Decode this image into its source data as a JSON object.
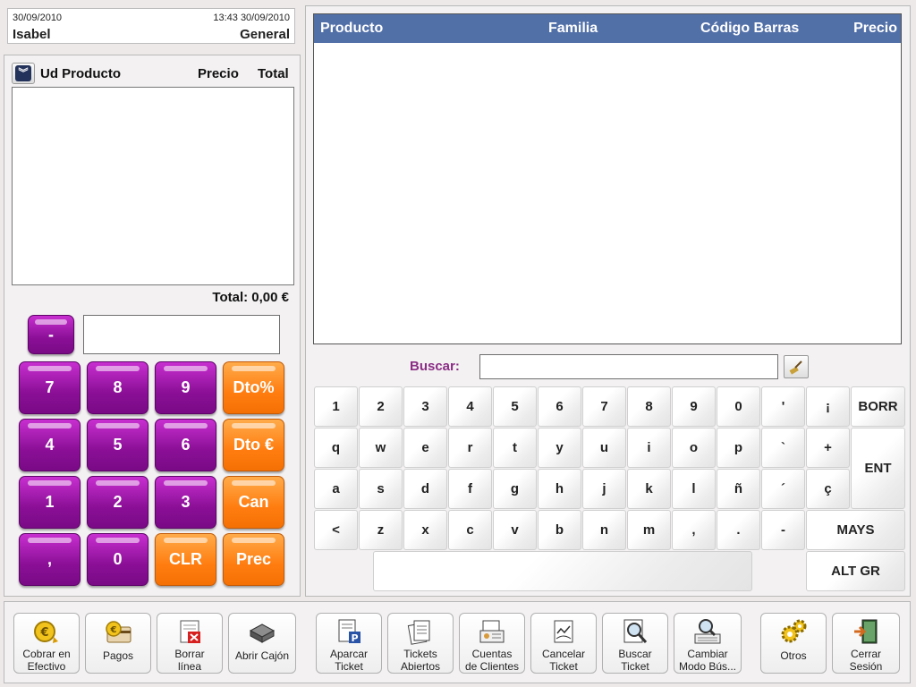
{
  "header": {
    "date_left": "30/09/2010",
    "datetime_right": "13:43 30/09/2010",
    "user": "Isabel",
    "terminal": "General"
  },
  "ticket": {
    "col_qty_product": "Ud Producto",
    "col_price": "Precio",
    "col_total": "Total",
    "total_label": "Total: 0,00 €",
    "quantity_value": ""
  },
  "keypad": {
    "minus": "-",
    "keys": [
      "7",
      "8",
      "9",
      "Dto%",
      "4",
      "5",
      "6",
      "Dto €",
      "1",
      "2",
      "3",
      "Can",
      ",",
      "0",
      "CLR",
      "Prec"
    ]
  },
  "products": {
    "col_product": "Producto",
    "col_family": "Familia",
    "col_barcode": "Código Barras",
    "col_price": "Precio"
  },
  "search": {
    "label": "Buscar:",
    "value": ""
  },
  "keyboard": {
    "row1": [
      "1",
      "2",
      "3",
      "4",
      "5",
      "6",
      "7",
      "8",
      "9",
      "0",
      "'",
      "¡"
    ],
    "row2": [
      "q",
      "w",
      "e",
      "r",
      "t",
      "y",
      "u",
      "i",
      "o",
      "p",
      "`",
      "+"
    ],
    "row3": [
      "a",
      "s",
      "d",
      "f",
      "g",
      "h",
      "j",
      "k",
      "l",
      "ñ",
      "´",
      "ç"
    ],
    "row4": [
      "<",
      "z",
      "x",
      "c",
      "v",
      "b",
      "n",
      "m",
      ",",
      ".",
      "-"
    ],
    "borr": "BORR",
    "ent": "ENT",
    "mays": "MAYS",
    "altgr": "ALT GR"
  },
  "toolbar": {
    "cobrar": "Cobrar en\nEfectivo",
    "pagos": "Pagos",
    "borrar": "Borrar\nlínea",
    "abrir": "Abrir Cajón",
    "aparcar": "Aparcar\nTicket",
    "tickets_abiertos": "Tickets\nAbiertos",
    "cuentas": "Cuentas\nde Clientes",
    "cancelar": "Cancelar\nTicket",
    "buscar_ticket": "Buscar\nTicket",
    "cambiar": "Cambiar\nModo Bús...",
    "otros": "Otros",
    "cerrar": "Cerrar\nSesión"
  },
  "icons": {
    "cobrar": "euro-coin-icon",
    "pagos": "card-euro-icon",
    "borrar": "delete-line-icon",
    "abrir": "cash-drawer-icon",
    "aparcar": "parking-ticket-icon",
    "tickets_abiertos": "documents-icon",
    "cuentas": "client-accounts-icon",
    "cancelar": "cancel-ticket-icon",
    "buscar_ticket": "magnifier-icon",
    "cambiar": "search-keyboard-icon",
    "otros": "gears-icon",
    "cerrar": "exit-door-icon"
  },
  "colors": {
    "table_header": "#5270a8",
    "key_purple": "#8a0f96",
    "key_orange": "#ff7d10",
    "search_label": "#8b2c86"
  }
}
